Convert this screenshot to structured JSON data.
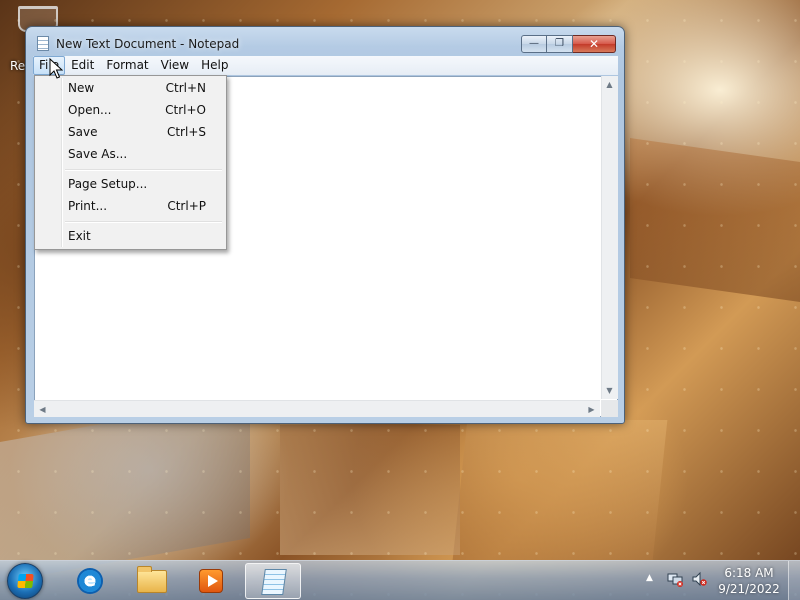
{
  "desktop": {
    "recycle_bin_label": "Rec"
  },
  "window": {
    "title": "New Text Document - Notepad",
    "caption_buttons": {
      "minimize": "—",
      "maximize": "❐",
      "close": "✕"
    }
  },
  "menubar": {
    "items": [
      {
        "label": "File",
        "active": true
      },
      {
        "label": "Edit"
      },
      {
        "label": "Format"
      },
      {
        "label": "View"
      },
      {
        "label": "Help"
      }
    ]
  },
  "file_menu": {
    "items": [
      {
        "label": "New",
        "shortcut": "Ctrl+N"
      },
      {
        "label": "Open...",
        "shortcut": "Ctrl+O"
      },
      {
        "label": "Save",
        "shortcut": "Ctrl+S"
      },
      {
        "label": "Save As...",
        "shortcut": ""
      },
      {
        "label": "Page Setup...",
        "shortcut": ""
      },
      {
        "label": "Print...",
        "shortcut": "Ctrl+P"
      },
      {
        "label": "Exit",
        "shortcut": ""
      }
    ]
  },
  "editor": {
    "content": ""
  },
  "taskbar": {
    "pinned": [
      {
        "name": "internet-explorer-icon"
      },
      {
        "name": "windows-explorer-icon"
      },
      {
        "name": "media-player-icon"
      },
      {
        "name": "notepad-icon",
        "active": true
      }
    ],
    "tray": {
      "show_hidden_glyph": "▲",
      "clock_time": "6:18 AM",
      "clock_date": "9/21/2022"
    },
    "ie_glyph": "e"
  }
}
